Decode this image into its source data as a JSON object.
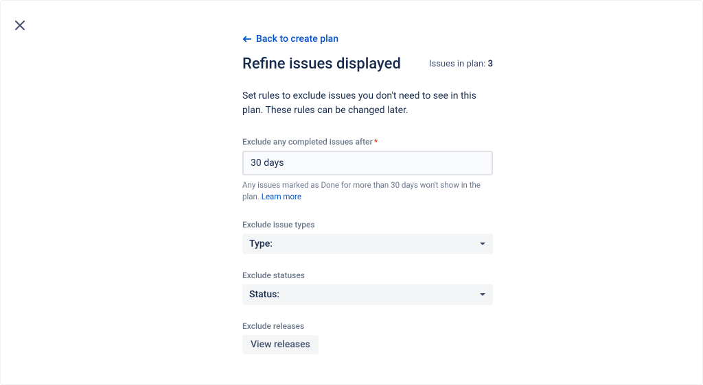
{
  "back_link": "Back to create plan",
  "title": "Refine issues displayed",
  "issues_in_plan_label": "Issues in plan:",
  "issues_in_plan_count": "3",
  "description": "Set rules to exclude issues you don't need to see in this plan. These rules can be changed later.",
  "fields": {
    "completed_after": {
      "label": "Exclude any completed issues after",
      "value": "30 days",
      "helper": "Any issues marked as Done for more than 30 days won't show in the plan.",
      "learn_more": "Learn more"
    },
    "issue_types": {
      "label": "Exclude issue types",
      "placeholder": "Type:"
    },
    "statuses": {
      "label": "Exclude statuses",
      "placeholder": "Status:"
    },
    "releases": {
      "label": "Exclude releases",
      "button": "View releases"
    }
  }
}
